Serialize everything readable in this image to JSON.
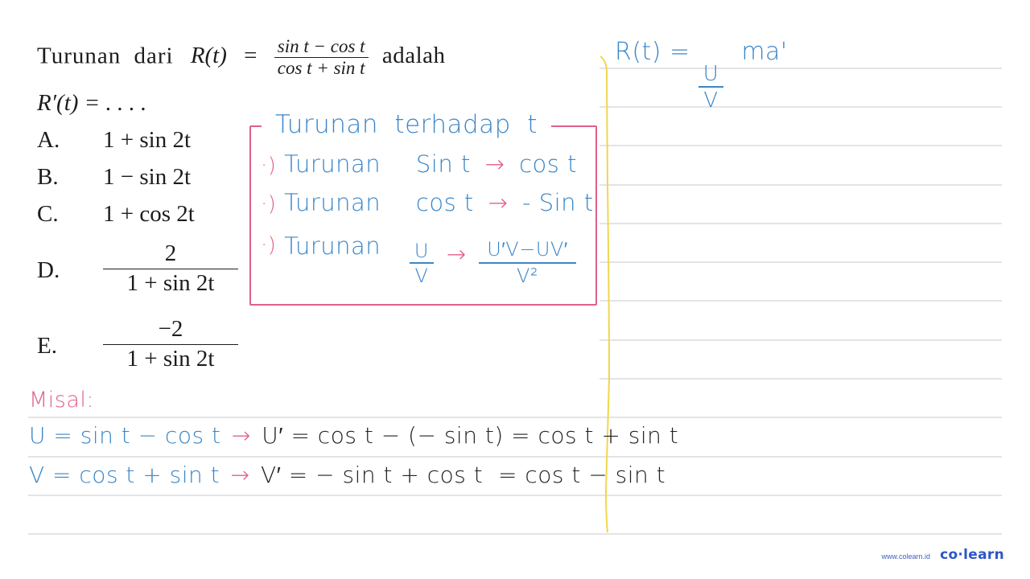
{
  "question": {
    "intro": "Turunan dari",
    "function_name": "R(t)",
    "equals": "=",
    "numerator": "sin t − cos t",
    "denominator": "cos t + sin t",
    "suffix": "adalah",
    "prompt": "R′(t) = . . . ."
  },
  "options": [
    {
      "letter": "A.",
      "text": "1 + sin 2t"
    },
    {
      "letter": "B.",
      "text": "1 − sin 2t"
    },
    {
      "letter": "C.",
      "text": "1 + cos 2t"
    },
    {
      "letter": "D.",
      "numerator": "2",
      "denominator": "1 + sin 2t"
    },
    {
      "letter": "E.",
      "numerator": "−2",
      "denominator": "1 + sin 2t"
    }
  ],
  "annotations": {
    "side_note": {
      "lhs": "R(t) =",
      "num": "U",
      "den": "V",
      "tail": "ma'"
    },
    "rules_box": {
      "title": "Turunan terhadap t",
      "rules": [
        {
          "bullet": "·)",
          "label": "Turunan",
          "from": "Sin t",
          "arrow": "→",
          "to": "cos t"
        },
        {
          "bullet": "·)",
          "label": "Turunan",
          "from": "cos t",
          "arrow": "→",
          "to": "- Sin t"
        },
        {
          "bullet": "·)",
          "label": "Turunan",
          "from_num": "U",
          "from_den": "V",
          "arrow": "→",
          "to_num": "U′V−UV′",
          "to_den": "V²"
        }
      ]
    },
    "misal": {
      "label": "Misal:",
      "lines": [
        {
          "lhs": "U = sin t − cos t",
          "arrow": "→",
          "rhs": "U′ = cos t − (− sin t) = cos t + sin t"
        },
        {
          "lhs": "V = cos t + sin t",
          "arrow": "→",
          "rhs": "V′ = − sin t + cos t  = cos t − sin t"
        }
      ]
    }
  },
  "colors": {
    "blue_ink": "#3a86c8",
    "pink_ink": "#e0608a",
    "black_ink": "#222222",
    "margin_yellow": "#f2d64b",
    "rule_gray": "#e4e4e6",
    "brand_blue": "#2c56c9"
  },
  "watermark": {
    "url": "www.colearn.id",
    "logo": "co·learn"
  }
}
